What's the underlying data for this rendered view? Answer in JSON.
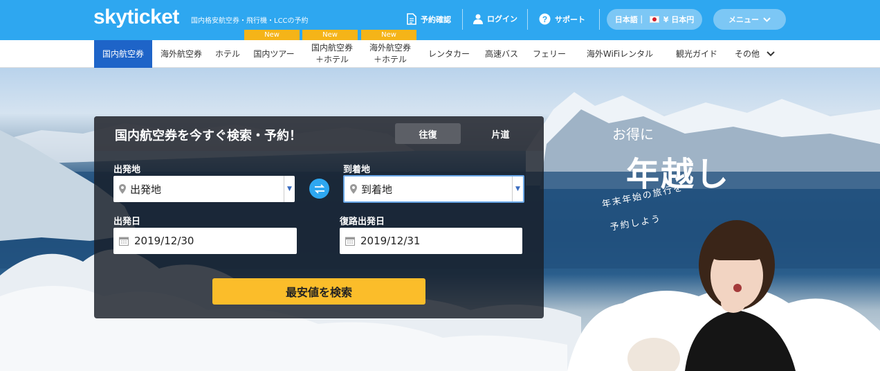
{
  "header": {
    "logo": "skyticket",
    "tagline": "国内格安航空券・飛行機・LCCの予約",
    "links": {
      "reservation": "予約確認",
      "login": "ログイン",
      "support": "サポート"
    },
    "language": "日本語｜",
    "currency": "¥ 日本円",
    "menu": "メニュー"
  },
  "nav": {
    "items": [
      {
        "label": "国内航空券"
      },
      {
        "label": "海外航空券"
      },
      {
        "label": "ホテル"
      },
      {
        "label": "国内ツアー"
      },
      {
        "line1": "国内航空券",
        "line2": "＋ホテル"
      },
      {
        "line1": "海外航空券",
        "line2": "＋ホテル"
      },
      {
        "label": "レンタカー"
      },
      {
        "label": "高速バス"
      },
      {
        "label": "フェリー"
      },
      {
        "label": "海外WiFiレンタル"
      },
      {
        "label": "観光ガイド"
      },
      {
        "label": "その他"
      }
    ],
    "new_badge": "New"
  },
  "search": {
    "title": "国内航空券を今すぐ検索・予約！",
    "trip_round": "往復",
    "trip_oneway": "片道",
    "from_label": "出発地",
    "from_placeholder": "出発地",
    "to_label": "到着地",
    "to_placeholder": "到着地",
    "depart_label": "出発日",
    "depart_value": "2019/12/30",
    "return_label": "復路出発日",
    "return_value": "2019/12/31",
    "submit": "最安値を検索"
  },
  "promo": {
    "line1": "お得に",
    "line2": "年越し",
    "line3": "年末年始の旅行を",
    "line4": "予約しよう"
  },
  "colors": {
    "header_bg": "#2ea7f0",
    "nav_active": "#1e64c8",
    "new_badge": "#f5b418",
    "search_button": "#fbbd2a"
  }
}
